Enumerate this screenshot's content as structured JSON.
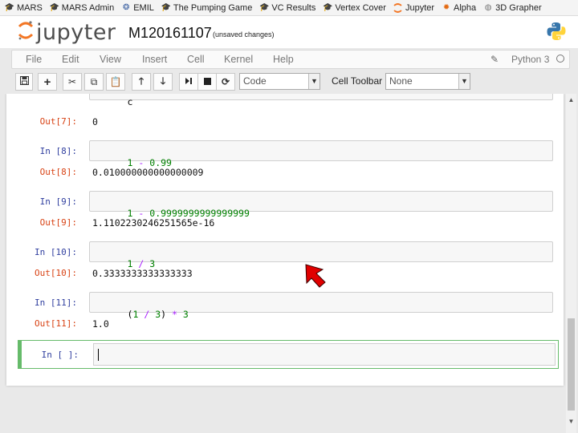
{
  "bookmarks": [
    {
      "label": "MARS",
      "icon": "hat-icon"
    },
    {
      "label": "MARS Admin",
      "icon": "hat-icon"
    },
    {
      "label": "EMIL",
      "icon": "emil-icon"
    },
    {
      "label": "The Pumping Game",
      "icon": "hat-icon"
    },
    {
      "label": "VC Results",
      "icon": "hat-icon"
    },
    {
      "label": "Vertex Cover",
      "icon": "hat-icon"
    },
    {
      "label": "Jupyter",
      "icon": "jupyter-icon"
    },
    {
      "label": "Alpha",
      "icon": "alpha-icon"
    },
    {
      "label": "3D Grapher",
      "icon": "grapher-icon"
    }
  ],
  "header": {
    "logo_text": "jupyter",
    "notebook_name": "M120161107",
    "status": "(unsaved changes)"
  },
  "menu": {
    "items": [
      "File",
      "Edit",
      "View",
      "Insert",
      "Cell",
      "Kernel",
      "Help"
    ],
    "kernel_name": "Python 3"
  },
  "toolbar": {
    "cell_type": "Code",
    "cell_toolbar_label": "Cell Toolbar",
    "cell_toolbar_value": "None"
  },
  "cells": {
    "partial_input": "c",
    "c7": {
      "out_prompt": "Out[7]:",
      "output": "0"
    },
    "c8": {
      "in_prompt": "In [8]:",
      "input_a": "1",
      "input_op": " - ",
      "input_b": "0.99",
      "out_prompt": "Out[8]:",
      "output": "0.010000000000000009"
    },
    "c9": {
      "in_prompt": "In [9]:",
      "input_a": "1",
      "input_op": " - ",
      "input_b": "0.9999999999999999",
      "out_prompt": "Out[9]:",
      "output": "1.1102230246251565e-16"
    },
    "c10": {
      "in_prompt": "In [10]:",
      "input_a": "1",
      "input_op": " / ",
      "input_b": "3",
      "out_prompt": "Out[10]:",
      "output": "0.3333333333333333"
    },
    "c11": {
      "in_prompt": "In [11]:",
      "input_p1": "(",
      "input_a": "1",
      "input_op": " / ",
      "input_b": "3",
      "input_p2": ")",
      "input_op2": " * ",
      "input_c": "3",
      "out_prompt": "Out[11]:",
      "output": "1.0"
    },
    "c_new": {
      "in_prompt": "In [ ]:"
    }
  },
  "colors": {
    "in_prompt": "#303f9f",
    "out_prompt": "#d84315",
    "number": "#008000",
    "operator": "#aa22ff",
    "selected_border": "#66bb6a",
    "cursor_pointer": "#e00000"
  }
}
